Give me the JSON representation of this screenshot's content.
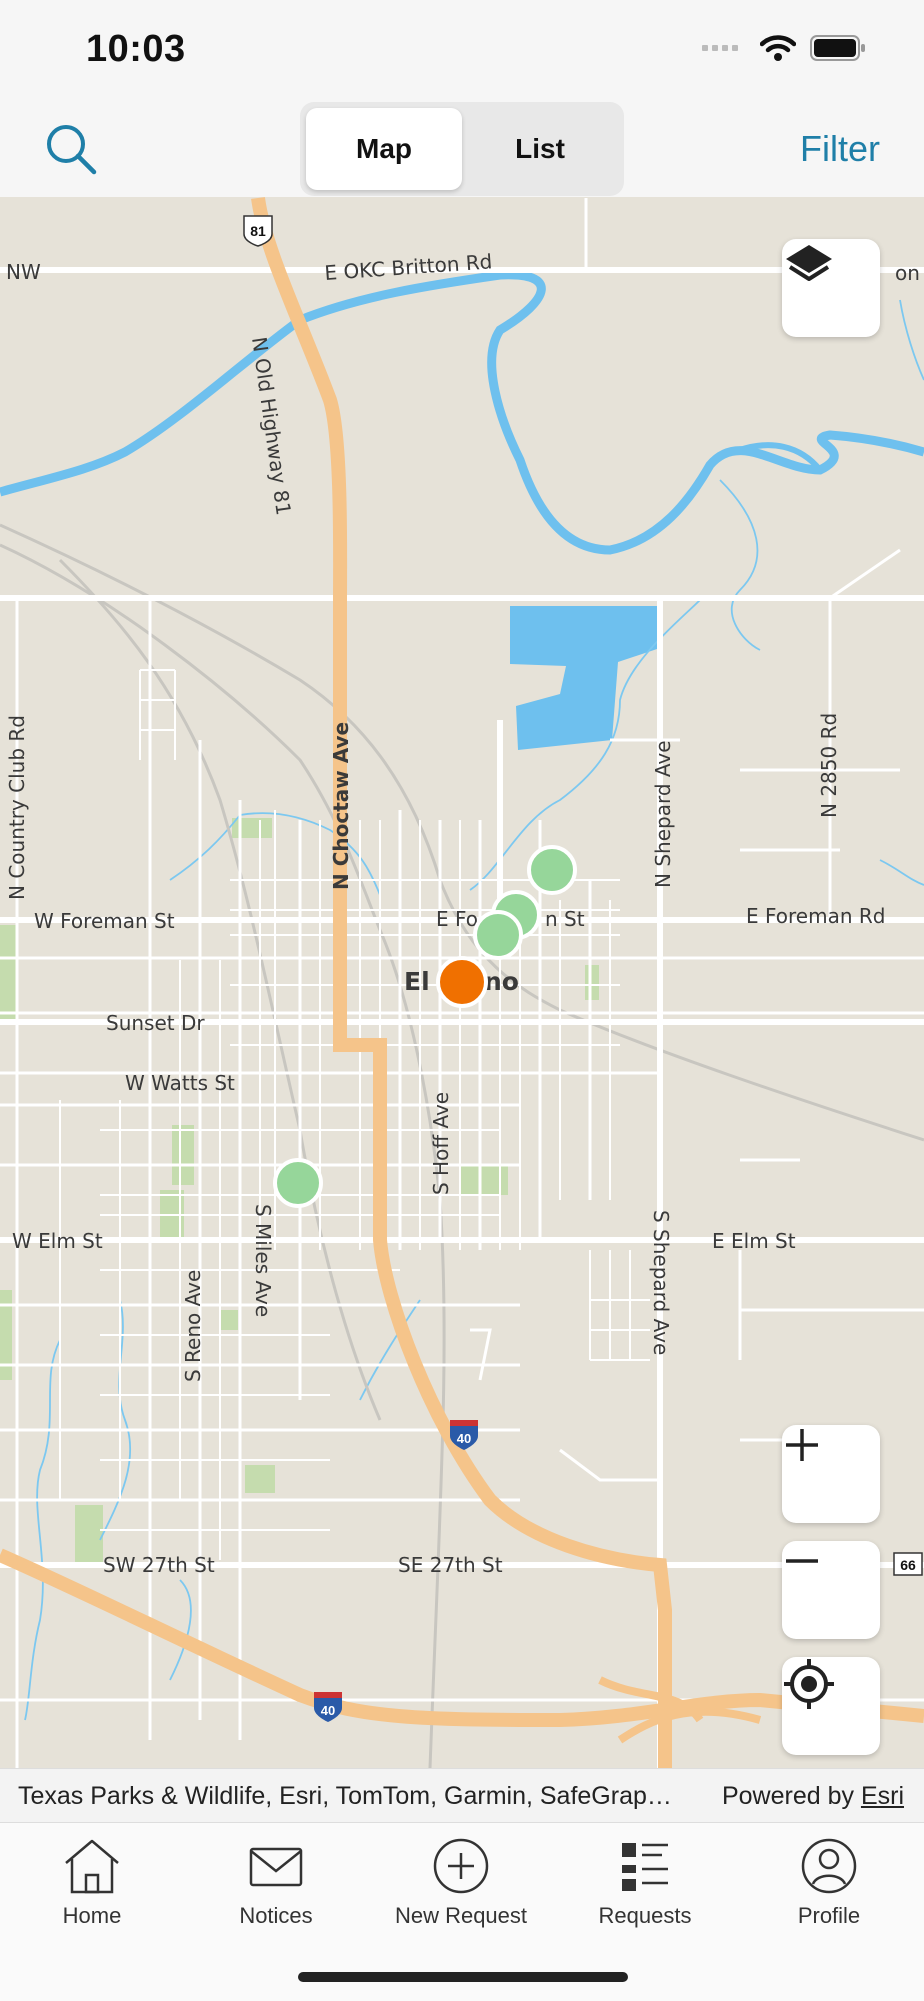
{
  "status_bar": {
    "time": "10:03"
  },
  "header": {
    "segments": [
      {
        "label": "Map",
        "active": true
      },
      {
        "label": "List",
        "active": false
      }
    ],
    "filter_label": "Filter",
    "search_icon": "search-icon"
  },
  "map": {
    "road_labels": {
      "britton": "E OKC Britton Rd",
      "nw": "NW",
      "britton_right": "on R",
      "old_hwy": "N Old Highway 81",
      "country_club": "N Country Club Rd",
      "choctaw": "N Choctaw Ave",
      "shepard_n": "N Shepard Ave",
      "r2850": "N 2850 Rd",
      "w_foreman": "W Foreman St",
      "e_foreman_st": "E Fo",
      "e_foreman_st2": "n St",
      "e_foreman_rd": "E Foreman Rd",
      "city": "El",
      "city2": "no",
      "sunset": "Sunset Dr",
      "watts": "W Watts St",
      "hoff": "S Hoff Ave",
      "w_elm": "W Elm St",
      "e_elm": "E Elm St",
      "miles": "S Miles Ave",
      "reno": "S Reno Ave",
      "shepard_s": "S Shepard Ave",
      "sw27": "SW 27th St",
      "se27": "SE 27th St"
    },
    "shields": {
      "us81": "81",
      "i40_a": "40",
      "i40_b": "40",
      "route66": "66"
    },
    "markers": [
      {
        "status": "open",
        "color": "#96d69a"
      },
      {
        "status": "open",
        "color": "#96d69a"
      },
      {
        "status": "open",
        "color": "#96d69a"
      },
      {
        "status": "open",
        "color": "#96d69a"
      },
      {
        "status": "selected",
        "color": "#f07000"
      }
    ],
    "controls": [
      "layers-icon",
      "zoom-in-icon",
      "zoom-out-icon",
      "locate-icon"
    ]
  },
  "attribution": {
    "sources": "Texas Parks & Wildlife, Esri, TomTom, Garmin, SafeGrap…",
    "powered_by": "Powered by",
    "esri_link": "Esri"
  },
  "tabs": [
    {
      "label": "Home",
      "icon": "home-icon"
    },
    {
      "label": "Notices",
      "icon": "mail-icon"
    },
    {
      "label": "New Request",
      "icon": "plus-circle-icon"
    },
    {
      "label": "Requests",
      "icon": "list-icon"
    },
    {
      "label": "Profile",
      "icon": "person-icon"
    }
  ],
  "colors": {
    "accent": "#1f7fa8",
    "water": "#6ec0ee",
    "highway": "#f5c48a",
    "land": "#e6e2d8"
  }
}
